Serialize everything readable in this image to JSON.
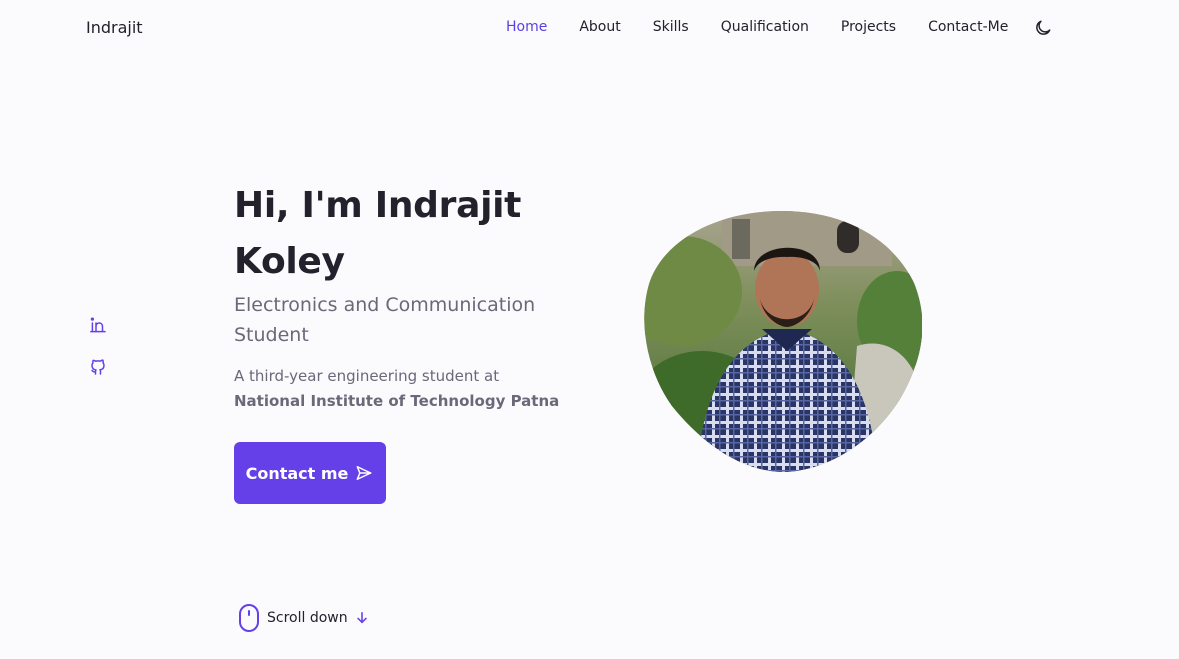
{
  "header": {
    "logo": "Indrajit",
    "nav": [
      {
        "label": "Home",
        "active": true
      },
      {
        "label": "About"
      },
      {
        "label": "Skills"
      },
      {
        "label": "Qualification"
      },
      {
        "label": "Projects"
      },
      {
        "label": "Contact-Me"
      }
    ],
    "theme_icon": "moon-icon"
  },
  "socials": [
    {
      "icon": "linkedin-icon"
    },
    {
      "icon": "github-icon"
    }
  ],
  "hero": {
    "title_line1": "Hi, I'm Indrajit",
    "title_line2": "Koley",
    "subtitle_line1": "Electronics and Communication",
    "subtitle_line2": "Student",
    "description": "A third-year engineering student at",
    "institution": "National Institute of Technology Patna",
    "cta_label": "Contact me",
    "cta_icon": "send-icon"
  },
  "scroll": {
    "label": "Scroll down",
    "icon": "mouse-icon",
    "arrow_icon": "arrow-down-icon"
  },
  "colors": {
    "accent": "#6540e8",
    "text": "#23212b",
    "muted": "#6b6879",
    "background": "#fbfbfe"
  }
}
